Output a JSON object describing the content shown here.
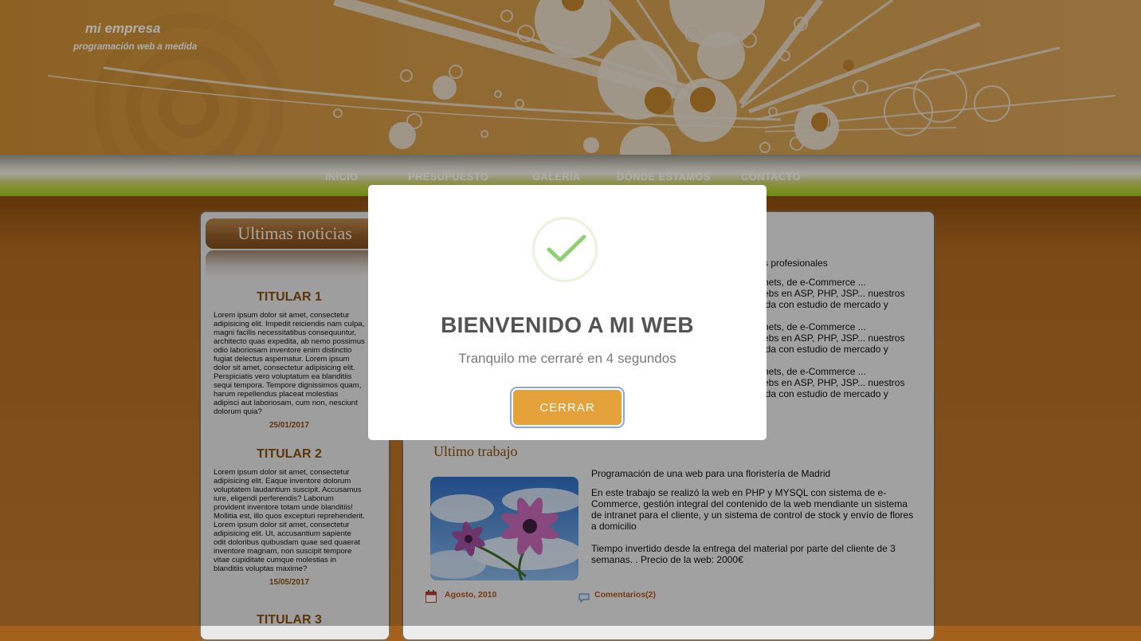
{
  "header": {
    "brand": "mi empresa",
    "tagline": "programación web a medida"
  },
  "nav": {
    "items": [
      "INICIO",
      "PRESUPUESTO",
      "GALERÍA",
      "DÓNDE ESTAMOS",
      "CONTACTO"
    ]
  },
  "sidebar": {
    "title": "Ultimas noticias",
    "news": [
      {
        "title": "TITULAR 1",
        "body": "Lorem ipsum dolor sit amet, consectetur adipisicing elit. Impedit reiciendis nam culpa, magni facilis necessitatibus consequuntur, architecto quas expedita, ab nemo possimus odio laboriosam inventore enim distinctio fugiat delectus aspernatur. Lorem ipsum dolor sit amet, consectetur adipisicing elit. Perspiciatis vero voluptatum ea blanditiis sequi tempora. Tempore dignissimos quam, harum repellendus placeat molestias adipisci aut laboriosam, cum non, nesciunt dolorum quia?",
        "date": "25/01/2017"
      },
      {
        "title": "TITULAR 2",
        "body": "Lorem ipsum dolor sit amet, consectetur adipisicing elit. Eaque inventore dolorum voluptatem laudantium suscipit. Accusamus iure, eligendi perferendis? Laborum provident inventore totam unde blanditiis! Mollitia est, illo quos excepturi reprehenderit. Lorem ipsum dolor sit amet, consectetur adipisicing elit. Ut, accusantium sapiente odit doloribus quibusdam quae sed quaerat inventore magnam, non suscipit tempore vitae cupiditate cumque molestias in blanditiis voluptas maxime?",
        "date": "15/05/2017"
      },
      {
        "title": "TITULAR 3"
      }
    ]
  },
  "main": {
    "partial": {
      "line0": "s profesionales",
      "line1": "nets, de e-Commerce ...",
      "line2": "ebs en ASP, PHP, JSP... nuestros",
      "line3": "ida con estudio de mercado y"
    },
    "work": {
      "title": "Ultimo trabajo",
      "headline": "Programación de una web para una floristería de Madrid",
      "description": "En este trabajo se realizó la web en PHP y MYSQL con sistema de e-Commerce, gestión integral del contenido de la web mendiante un sistema de intranet para el cliente, y un sistema de control de stock y envío de flores a domicilio",
      "time": "Tiempo invertido desde la entrega del material por parte del cliente de 3 semanas. . Precio de la web: 2000€",
      "date": "Agosto, 2010",
      "comments": "Comentarios(2)"
    }
  },
  "modal": {
    "title": "BIENVENIDO A MI WEB",
    "text": "Tranquilo me cerraré en 4 segundos",
    "button": "CERRAR"
  },
  "colors": {
    "accent": "#e6a23a",
    "brown": "#8a4f10",
    "check": "#8fd172"
  }
}
